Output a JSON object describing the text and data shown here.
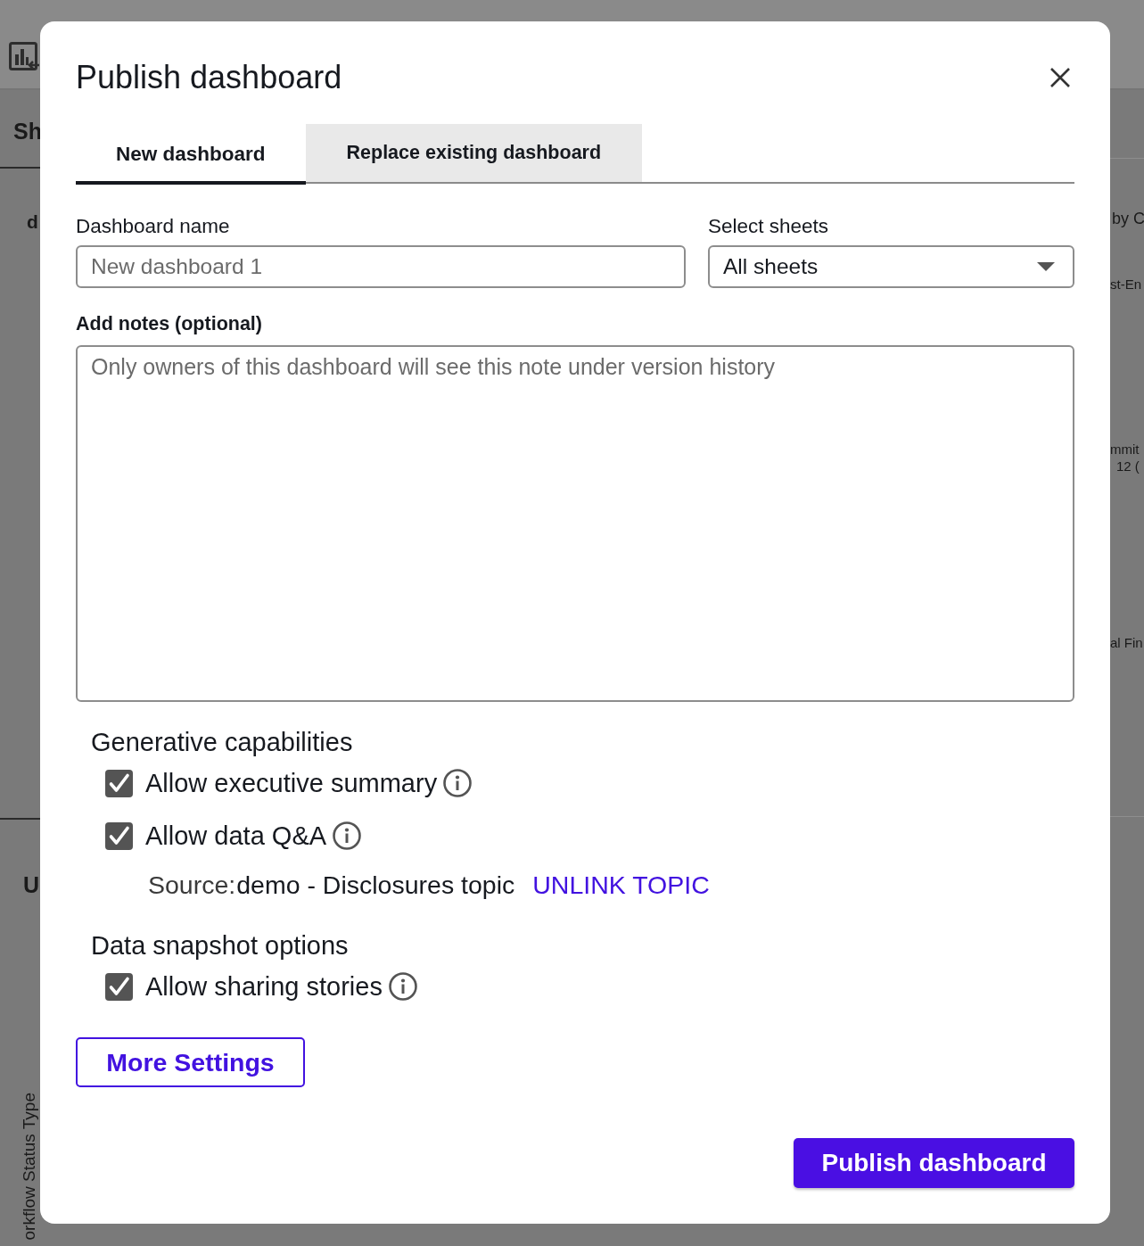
{
  "background": {
    "left_texts": [
      "Sh",
      "d",
      "U"
    ],
    "axis_title": "orkflow Status Type",
    "right_texts": [
      "by C",
      "st-En",
      "mmit",
      "12 (",
      "al Fin"
    ]
  },
  "dialog": {
    "title": "Publish dashboard"
  },
  "tabs": [
    {
      "label": "New dashboard",
      "selected": true
    },
    {
      "label": "Replace existing dashboard",
      "selected": false
    }
  ],
  "form": {
    "dashboard_name": {
      "label": "Dashboard name",
      "placeholder": "New dashboard 1"
    },
    "select_sheets": {
      "label": "Select sheets",
      "value": "All sheets"
    },
    "notes": {
      "label": "Add notes (optional)",
      "placeholder": "Only owners of this dashboard will see this note under version history"
    }
  },
  "sections": [
    {
      "title": "Generative capabilities",
      "options": [
        {
          "label": "Allow executive summary",
          "checked": true
        },
        {
          "label": "Allow data Q&A",
          "checked": true,
          "source": {
            "label": "Source:",
            "topic": "demo - Disclosures topic",
            "link": "UNLINK TOPIC"
          }
        }
      ]
    },
    {
      "title": "Data snapshot options",
      "options": [
        {
          "label": "Allow sharing stories",
          "checked": true
        }
      ]
    }
  ],
  "buttons": {
    "more_settings": "More Settings",
    "publish": "Publish dashboard"
  }
}
